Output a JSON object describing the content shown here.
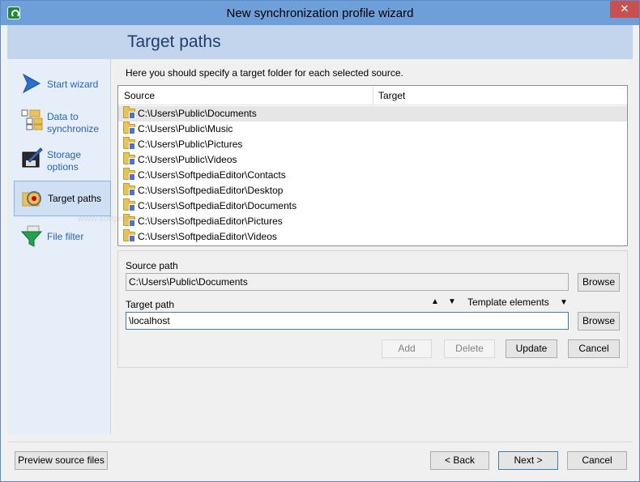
{
  "window": {
    "title": "New synchronization profile wizard"
  },
  "nav": {
    "items": [
      {
        "label": "Start wizard",
        "icon": "arrow-right-icon"
      },
      {
        "label": "Data to synchronize",
        "icon": "data-selection-icon"
      },
      {
        "label": "Storage options",
        "icon": "storage-disk-icon"
      },
      {
        "label": "Target paths",
        "icon": "target-paths-icon",
        "active": true
      },
      {
        "label": "File filter",
        "icon": "funnel-icon"
      }
    ]
  },
  "page": {
    "title": "Target paths",
    "instruction": "Here you should specify a target folder for each selected source."
  },
  "grid": {
    "columns": [
      "Source",
      "Target"
    ],
    "rows": [
      {
        "source": "C:\\Users\\Public\\Documents",
        "target": "",
        "selected": true
      },
      {
        "source": "C:\\Users\\Public\\Music",
        "target": ""
      },
      {
        "source": "C:\\Users\\Public\\Pictures",
        "target": ""
      },
      {
        "source": "C:\\Users\\Public\\Videos",
        "target": ""
      },
      {
        "source": "C:\\Users\\SoftpediaEditor\\Contacts",
        "target": ""
      },
      {
        "source": "C:\\Users\\SoftpediaEditor\\Desktop",
        "target": ""
      },
      {
        "source": "C:\\Users\\SoftpediaEditor\\Documents",
        "target": ""
      },
      {
        "source": "C:\\Users\\SoftpediaEditor\\Pictures",
        "target": ""
      },
      {
        "source": "C:\\Users\\SoftpediaEditor\\Videos",
        "target": ""
      }
    ]
  },
  "form": {
    "source_label": "Source path",
    "source_value": "C:\\Users\\Public\\Documents",
    "target_label": "Target path",
    "target_value": "\\localhost",
    "template_label": "Template elements",
    "browse": "Browse",
    "add": "Add",
    "delete": "Delete",
    "update": "Update",
    "cancel": "Cancel"
  },
  "footer": {
    "preview": "Preview source files",
    "back": "< Back",
    "next": "Next >",
    "cancel": "Cancel"
  },
  "watermark": "www.softpedia.com",
  "colors": {
    "titlebar": "#6f9fd8",
    "header": "#c3d5ec",
    "nav_link": "#2b63b6",
    "close": "#c75050"
  }
}
